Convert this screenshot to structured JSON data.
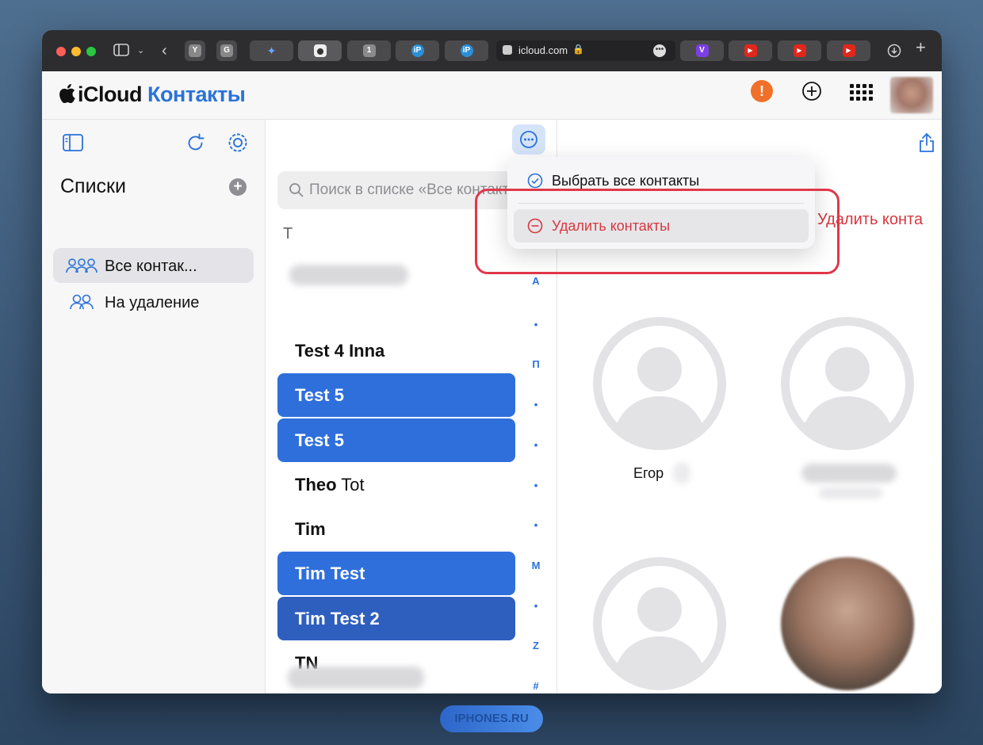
{
  "browser": {
    "address": "icloud.com",
    "tabs": [
      {
        "icon": "y-favicon-icon",
        "text": "Y"
      },
      {
        "icon": "g-favicon-icon",
        "text": "G"
      },
      {
        "icon": "sparkle-favicon-icon",
        "text": "✦"
      },
      {
        "icon": "apple-favicon-icon",
        "text": ""
      },
      {
        "icon": "one-favicon-icon",
        "text": "1"
      },
      {
        "icon": "ip-favicon-icon",
        "text": "iP"
      },
      {
        "icon": "ip-favicon-icon",
        "text": "iP"
      },
      {
        "icon": "v-favicon-icon",
        "text": "V"
      },
      {
        "icon": "youtube-favicon-icon",
        "text": "▶"
      },
      {
        "icon": "youtube-favicon-icon",
        "text": "▶"
      },
      {
        "icon": "youtube-favicon-icon",
        "text": "▶"
      }
    ]
  },
  "header": {
    "brand": "iCloud",
    "app": "Контакты",
    "alert": "!"
  },
  "sidebar": {
    "title": "Списки",
    "items": [
      {
        "label": "Все контак...",
        "selected": true
      },
      {
        "label": "На удаление",
        "selected": false
      }
    ]
  },
  "list": {
    "search_placeholder": "Поиск в списке «Все контакты»",
    "section": "T",
    "rows": [
      {
        "first": "Test 4 Inna",
        "last": ""
      },
      {
        "first": "Test 5",
        "last": ""
      },
      {
        "first": "Test 5",
        "last": ""
      },
      {
        "first": "Theo",
        "last": "Tot"
      },
      {
        "first": "Tim",
        "last": ""
      },
      {
        "first": "Tim Test",
        "last": ""
      },
      {
        "first": "Tim Test 2",
        "last": ""
      },
      {
        "first": "TN",
        "last": ""
      }
    ],
    "index": [
      "А",
      "•",
      "П",
      "•",
      "•",
      "•",
      "•",
      "М",
      "•",
      "Z",
      "#"
    ]
  },
  "menu": {
    "select_all": "Выбрать все контакты",
    "delete": "Удалить контакты"
  },
  "detail": {
    "delete_label": "Удалить конта",
    "contact_name": "Егор"
  },
  "colors": {
    "accent": "#2b72d9",
    "selection": "#2f6fdc",
    "destructive": "#d7373f",
    "highlight_frame": "#e0384a",
    "alert": "#f0702a"
  },
  "watermark": "IPHONES.RU"
}
